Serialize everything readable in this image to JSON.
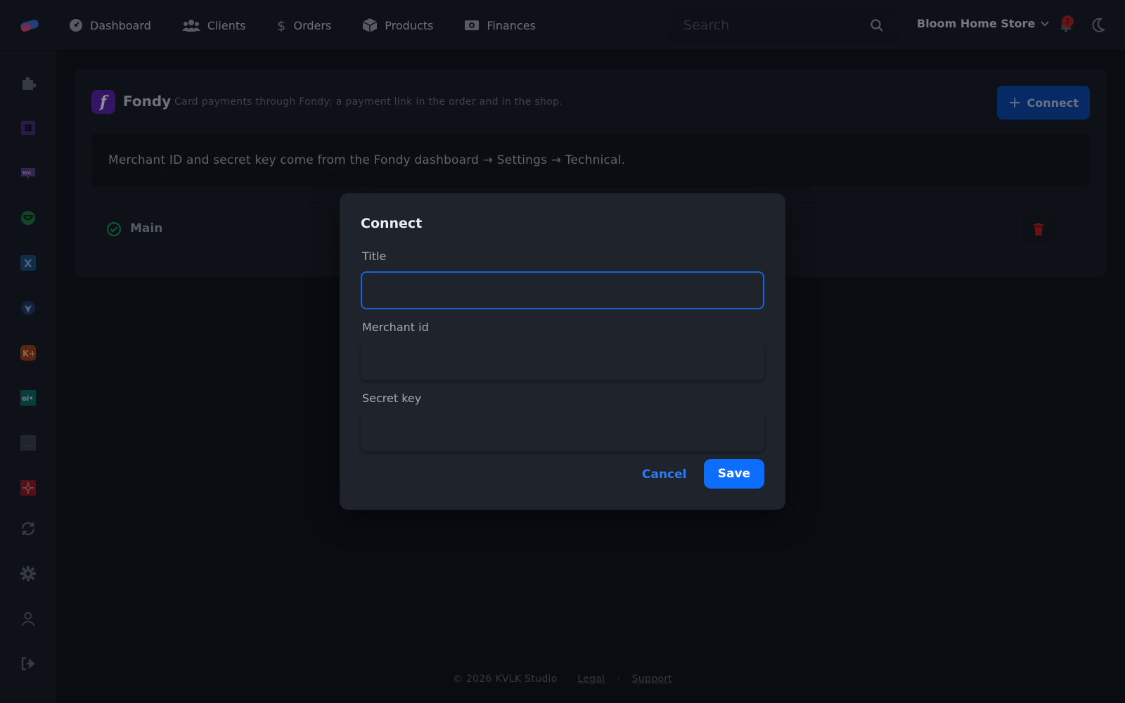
{
  "topbar": {
    "nav": [
      {
        "label": "Dashboard",
        "icon": "dashboard-icon"
      },
      {
        "label": "Clients",
        "icon": "users-icon"
      },
      {
        "label": "Orders",
        "icon": "dollar-icon"
      },
      {
        "label": "Products",
        "icon": "box-icon"
      },
      {
        "label": "Finances",
        "icon": "money-icon"
      }
    ],
    "search_placeholder": "Search",
    "store_name": "Bloom Home Store",
    "notification_count": "2"
  },
  "sidebar": {
    "items": [
      "puzzle-icon",
      "square-app-icon",
      "woocommerce-icon",
      "green-app-icon",
      "x-app-icon",
      "diamond-app-icon",
      "k-plus-app-icon",
      "ol-app-icon",
      "gray-app-icon",
      "red-app-icon",
      "sync-icon",
      "gear-icon",
      "user-icon",
      "logout-icon"
    ]
  },
  "integration": {
    "logo_letter": "f",
    "name": "Fondy",
    "description": "Card payments through Fondy: a payment link in the order and in the shop.",
    "connect_label": "Connect",
    "info": "Merchant ID and secret key come from the Fondy dashboard → Settings → Technical.",
    "connections": [
      {
        "name": "Main",
        "status": "connected"
      }
    ]
  },
  "modal": {
    "title": "Connect",
    "fields": [
      {
        "label": "Title",
        "value": ""
      },
      {
        "label": "Merchant id",
        "value": ""
      },
      {
        "label": "Secret key",
        "value": ""
      }
    ],
    "cancel_label": "Cancel",
    "save_label": "Save"
  },
  "footer": {
    "copyright": "© 2026 KVLK Studio",
    "legal": "Legal",
    "separator": "·",
    "support": "Support"
  },
  "colors": {
    "accent": "#0d6efd",
    "brand_fondy": "#5b1fb0",
    "danger": "#b51e1e",
    "success": "#1f9d55"
  }
}
